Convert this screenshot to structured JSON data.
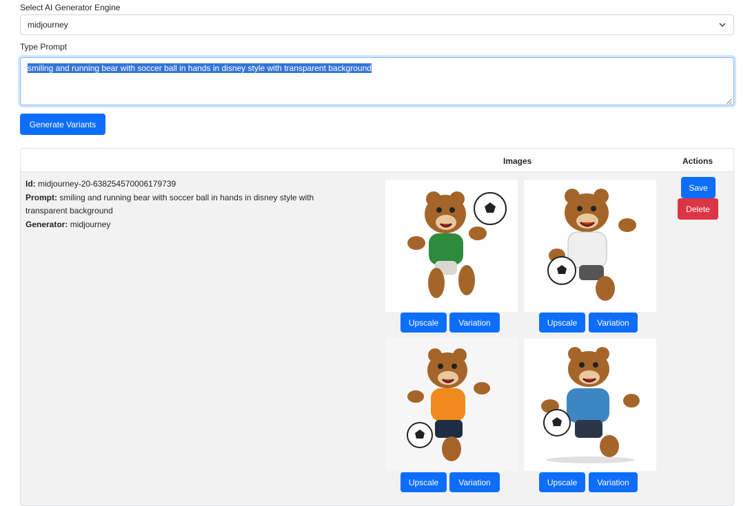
{
  "engine": {
    "label": "Select AI Generator Engine",
    "selected": "midjourney"
  },
  "prompt": {
    "label": "Type Prompt",
    "value": "smiling and running bear with soccer ball in hands  in disney style with transparent background"
  },
  "generate_button": "Generate Variants",
  "table": {
    "headers": {
      "images": "Images",
      "actions": "Actions"
    },
    "row": {
      "id_label": "Id:",
      "id_value": "midjourney-20-638254570006179739",
      "prompt_label": "Prompt:",
      "prompt_value": "smiling and running bear with soccer ball in hands in disney style with transparent background",
      "generator_label": "Generator:",
      "generator_value": "midjourney",
      "images": [
        {
          "shirt_color": "#2e8b3e",
          "upscale": "Upscale",
          "variation": "Variation"
        },
        {
          "shirt_color": "#efefef",
          "upscale": "Upscale",
          "variation": "Variation"
        },
        {
          "shirt_color": "#f08a1c",
          "upscale": "Upscale",
          "variation": "Variation"
        },
        {
          "shirt_color": "#3b87c4",
          "upscale": "Upscale",
          "variation": "Variation"
        }
      ],
      "actions": {
        "save": "Save",
        "delete": "Delete"
      }
    }
  },
  "colors": {
    "primary": "#0d6efd",
    "danger": "#dc3545",
    "bear_fur": "#a5652a"
  }
}
